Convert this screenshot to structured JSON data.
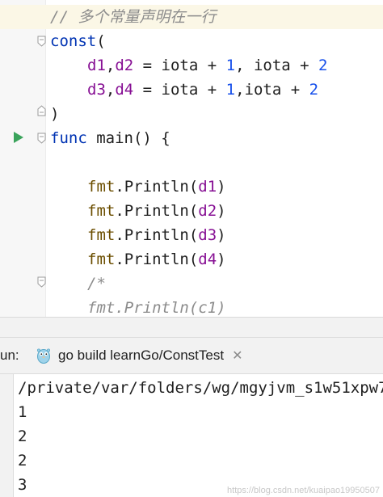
{
  "editor": {
    "lines": {
      "comment": "// 多个常量声明在一行",
      "const_kw": "const",
      "const_paren": "(",
      "l3_a": "d1",
      "l3_b": ",",
      "l3_c": "d2",
      "l3_d": " = iota + ",
      "l3_e": "1",
      "l3_f": ", iota + ",
      "l3_g": "2",
      "l4_a": "d3",
      "l4_b": ",",
      "l4_c": "d4",
      "l4_d": " = iota + ",
      "l4_e": "1",
      "l4_f": ",iota + ",
      "l4_g": "2",
      "close_paren": ")",
      "func_kw": "func",
      "func_rest": " main() {",
      "println": [
        {
          "pkg": "fmt",
          "call": ".Println(",
          "arg": "d1",
          "end": ")"
        },
        {
          "pkg": "fmt",
          "call": ".Println(",
          "arg": "d2",
          "end": ")"
        },
        {
          "pkg": "fmt",
          "call": ".Println(",
          "arg": "d3",
          "end": ")"
        },
        {
          "pkg": "fmt",
          "call": ".Println(",
          "arg": "d4",
          "end": ")"
        }
      ],
      "block_comment_open": "/*",
      "block_comment_line": "fmt.Println(c1)"
    }
  },
  "run_panel": {
    "label": "un:",
    "tab_label": "go build learnGo/ConstTest",
    "close": "✕"
  },
  "console": {
    "path": "/private/var/folders/wg/mgyjvm_s1w51xpw7",
    "output": [
      "1",
      "2",
      "2",
      "3"
    ]
  },
  "watermark": "https://blog.csdn.net/kuaipao19950507",
  "colors": {
    "keyword": "#0033b3",
    "number": "#1750eb",
    "variable": "#871094",
    "package": "#6b4e00",
    "comment": "#8c8c8c",
    "run_green": "#3aa35b"
  },
  "icons": [
    "run-arrow-icon",
    "fold-marker-icon",
    "gopher-icon",
    "close-icon"
  ]
}
